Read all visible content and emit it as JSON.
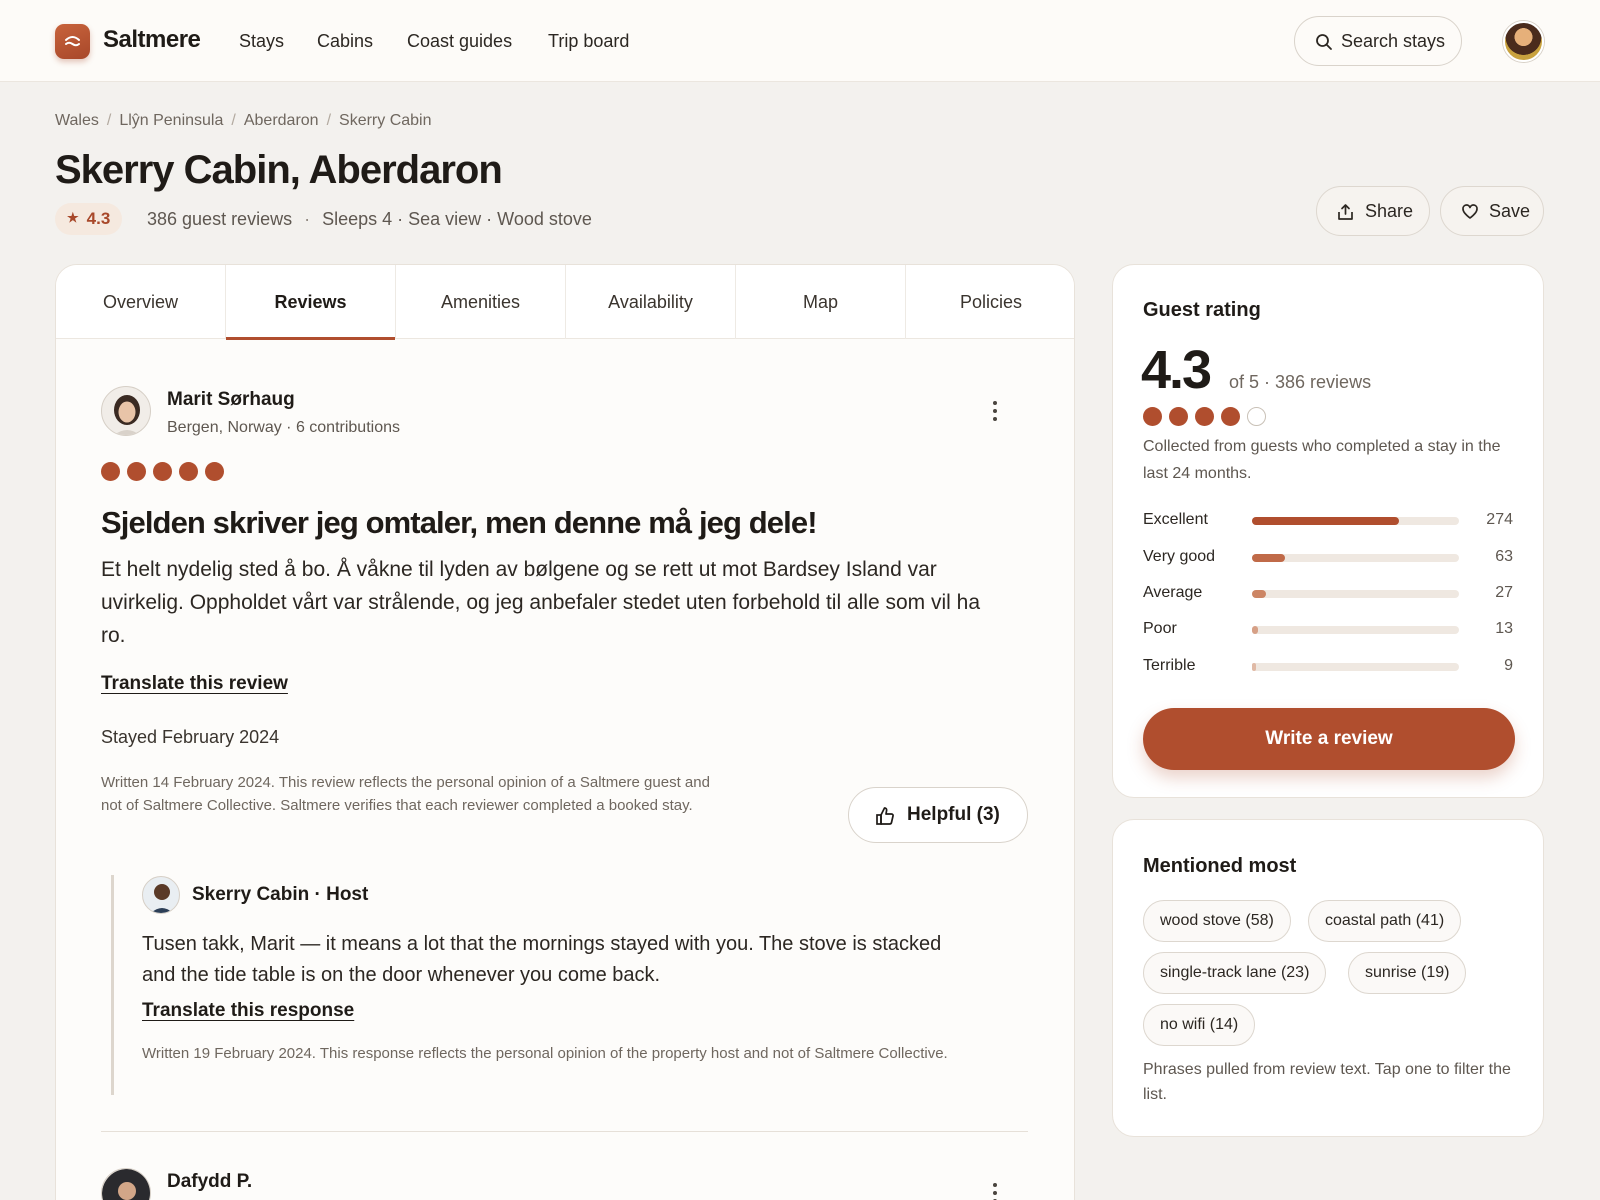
{
  "header": {
    "brand": "Saltmere",
    "nav": [
      "Stays",
      "Cabins",
      "Coast guides",
      "Trip board"
    ],
    "search_label": "Search stays"
  },
  "listing": {
    "breadcrumbs": [
      "Wales",
      "Llŷn Peninsula",
      "Aberdaron",
      "Skerry Cabin"
    ],
    "title": "Skerry Cabin, Aberdaron",
    "rating": "4.3",
    "review_count": "386 guest reviews",
    "features": "Sleeps 4 · Sea view · Wood stove",
    "share_label": "Share",
    "save_label": "Save"
  },
  "tabs": [
    "Overview",
    "Reviews",
    "Amenities",
    "Availability",
    "Map",
    "Policies"
  ],
  "active_tab": "Reviews",
  "review": {
    "author": "Marit Sørhaug",
    "author_meta": "Bergen, Norway · 6 contributions",
    "rating": 5,
    "headline": "Sjelden skriver jeg omtaler, men denne må jeg dele!",
    "body": "Et helt nydelig sted å bo. Å våkne til lyden av bølgene og se rett ut mot Bardsey Island var uvirkelig. Oppholdet vårt var strålende, og jeg anbefaler stedet uten forbehold til alle som vil ha ro.",
    "translate_label": "Translate this review",
    "stayed": "Stayed February 2024",
    "disclaimer": "Written 14 February 2024. This review reflects the personal opinion of a Saltmere guest and not of Saltmere Collective. Saltmere verifies that each reviewer completed a booked stay.",
    "helpful_label": "Helpful (3)",
    "host_response": {
      "author": "Skerry Cabin · Host",
      "body": "Tusen takk, Marit — it means a lot that the mornings stayed with you. The stove is stacked and the tide table is on the door whenever you come back.",
      "translate_label": "Translate this response",
      "disclaimer": "Written 19 February 2024. This response reflects the personal opinion of the property host and not of Saltmere Collective."
    }
  },
  "next_review": {
    "author": "Dafydd P."
  },
  "guest_rating": {
    "title": "Guest rating",
    "score": "4.3",
    "score_meta": "of 5 · 386 reviews",
    "stars": 4,
    "note": "Collected from guests who completed a stay in the last 24 months.",
    "breakdown": [
      {
        "label": "Excellent",
        "count": 274,
        "fraction": 0.71,
        "color": "#b04e2e"
      },
      {
        "label": "Very good",
        "count": 63,
        "fraction": 0.16,
        "color": "#c06a48"
      },
      {
        "label": "Average",
        "count": 27,
        "fraction": 0.07,
        "color": "#cc8564"
      },
      {
        "label": "Poor",
        "count": 13,
        "fraction": 0.03,
        "color": "#d6a086"
      },
      {
        "label": "Terrible",
        "count": 9,
        "fraction": 0.01,
        "color": "#e0baa6"
      }
    ],
    "write_label": "Write a review"
  },
  "mentioned": {
    "title": "Mentioned most",
    "chips": [
      "wood stove (58)",
      "coastal path (41)",
      "single-track lane (23)",
      "sunrise (19)",
      "no wifi (14)"
    ],
    "note": "Phrases pulled from review text. Tap one to filter the list."
  },
  "colors": {
    "accent": "#b04e2e",
    "background": "#f3f1ee"
  }
}
